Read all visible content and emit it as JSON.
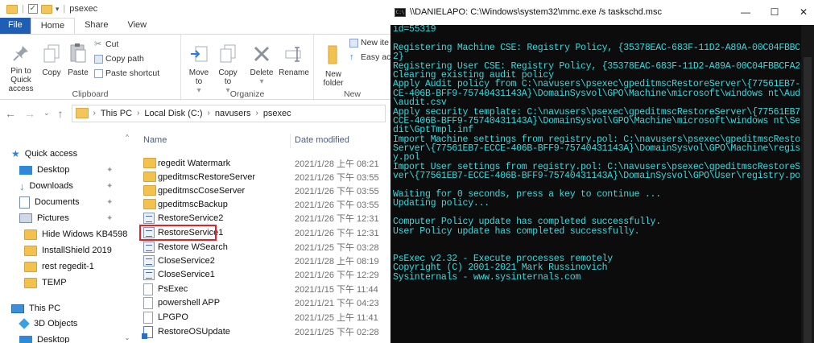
{
  "explorer": {
    "window_title": "psexec",
    "ribbon_tabs": [
      "File",
      "Home",
      "Share",
      "View"
    ],
    "clipboard": {
      "pin_label": "Pin to Quick access",
      "copy_label": "Copy",
      "paste_label": "Paste",
      "cut_label": "Cut",
      "copy_path_label": "Copy path",
      "paste_shortcut_label": "Paste shortcut",
      "group_label": "Clipboard"
    },
    "organize": {
      "move_to_label": "Move to",
      "copy_to_label": "Copy to",
      "delete_label": "Delete",
      "rename_label": "Rename",
      "group_label": "Organize"
    },
    "new_group": {
      "new_folder_label": "New folder",
      "new_item_label": "New ite",
      "easy_access_label": "Easy ac",
      "group_label": "New"
    },
    "breadcrumbs": [
      "This PC",
      "Local Disk (C:)",
      "navusers",
      "psexec"
    ],
    "nav_pane": [
      {
        "label": "Quick access",
        "icon": "star-icon",
        "pinned": false
      },
      {
        "label": "Desktop",
        "icon": "desktop-icon",
        "pinned": true
      },
      {
        "label": "Downloads",
        "icon": "download-icon",
        "pinned": true
      },
      {
        "label": "Documents",
        "icon": "documents-icon",
        "pinned": true
      },
      {
        "label": "Pictures",
        "icon": "pictures-icon",
        "pinned": true
      },
      {
        "label": "Hide Widows KB4598",
        "icon": "folder-icon",
        "pinned": false
      },
      {
        "label": "InstallShield 2019",
        "icon": "folder-icon",
        "pinned": false
      },
      {
        "label": "rest regedit-1",
        "icon": "folder-icon",
        "pinned": false
      },
      {
        "label": "TEMP",
        "icon": "folder-icon",
        "pinned": false
      },
      {
        "label": "This PC",
        "icon": "computer-icon",
        "pinned": false
      },
      {
        "label": "3D Objects",
        "icon": "objects-3d-icon",
        "pinned": false
      },
      {
        "label": "Desktop",
        "icon": "desktop-icon",
        "pinned": false
      }
    ],
    "columns": {
      "name": "Name",
      "date": "Date modified"
    },
    "files": [
      {
        "name": "regedit Watermark",
        "date": "2021/1/28 上午 08:21",
        "type": "folder"
      },
      {
        "name": "gpeditmscRestoreServer",
        "date": "2021/1/26 下午 03:55",
        "type": "folder"
      },
      {
        "name": "gpeditmscCoseServer",
        "date": "2021/1/26 下午 03:55",
        "type": "folder"
      },
      {
        "name": "gpeditmscBackup",
        "date": "2021/1/26 下午 03:55",
        "type": "folder"
      },
      {
        "name": "RestoreService2",
        "date": "2021/1/26 下午 12:31",
        "type": "service"
      },
      {
        "name": "RestoreService1",
        "date": "2021/1/26 下午 12:31",
        "type": "service"
      },
      {
        "name": "Restore WSearch",
        "date": "2021/1/25 下午 03:28",
        "type": "service"
      },
      {
        "name": "CloseService2",
        "date": "2021/1/28 上午 08:19",
        "type": "service"
      },
      {
        "name": "CloseService1",
        "date": "2021/1/26 下午 12:29",
        "type": "service"
      },
      {
        "name": "PsExec",
        "date": "2021/1/15 下午 11:44",
        "type": "file"
      },
      {
        "name": "powershell APP",
        "date": "2021/1/21 下午 04:23",
        "type": "file"
      },
      {
        "name": "LPGPO",
        "date": "2021/1/25 上午 11:41",
        "type": "file"
      },
      {
        "name": "RestoreOSUpdate",
        "date": "2021/1/25 下午 02:28",
        "type": "doc"
      }
    ],
    "highlight_color": "#e0232a"
  },
  "console": {
    "title": "\\\\DANIELAPO: C:\\Windows\\system32\\mmc.exe /s taskschd.msc",
    "buttons": {
      "minimize": "—",
      "maximize": "☐",
      "close": "✕"
    },
    "text_color": "#3fd7dc",
    "background": "#0c0c0c",
    "lines": [
      "id=55319",
      "",
      "Registering Machine CSE: Registry Policy, {35378EAC-683F-11D2-A89A-00C04FBBCFA",
      "2}",
      "Registering User CSE: Registry Policy, {35378EAC-683F-11D2-A89A-00C04FBBCFA2}",
      "Clearing existing audit policy",
      "Apply Audit policy from C:\\navusers\\psexec\\gpeditmscRestoreServer\\{77561EB7-EC",
      "CE-406B-BFF9-75740431143A}\\DomainSysvol\\GPO\\Machine\\microsoft\\windows nt\\Audit",
      "\\audit.csv",
      "Apply security template: C:\\navusers\\psexec\\gpeditmscRestoreServer\\{77561EB7-E",
      "CCE-406B-BFF9-75740431143A}\\DomainSysvol\\GPO\\Machine\\microsoft\\windows nt\\SecE",
      "dit\\GptTmpl.inf",
      "Import Machine settings from registry.pol: C:\\navusers\\psexec\\gpeditmscRestore",
      "Server\\{77561EB7-ECCE-406B-BFF9-75740431143A}\\DomainSysvol\\GPO\\Machine\\registr",
      "y.pol",
      "Import User settings from registry.pol: C:\\navusers\\psexec\\gpeditmscRestoreSer",
      "ver\\{77561EB7-ECCE-406B-BFF9-75740431143A}\\DomainSysvol\\GPO\\User\\registry.pol",
      "",
      "Waiting for 0 seconds, press a key to continue ...",
      "Updating policy...",
      "",
      "Computer Policy update has completed successfully.",
      "User Policy update has completed successfully.",
      "",
      "",
      "PsExec v2.32 - Execute processes remotely",
      "Copyright (C) 2001-2021 Mark Russinovich",
      "Sysinternals - www.sysinternals.com"
    ]
  }
}
